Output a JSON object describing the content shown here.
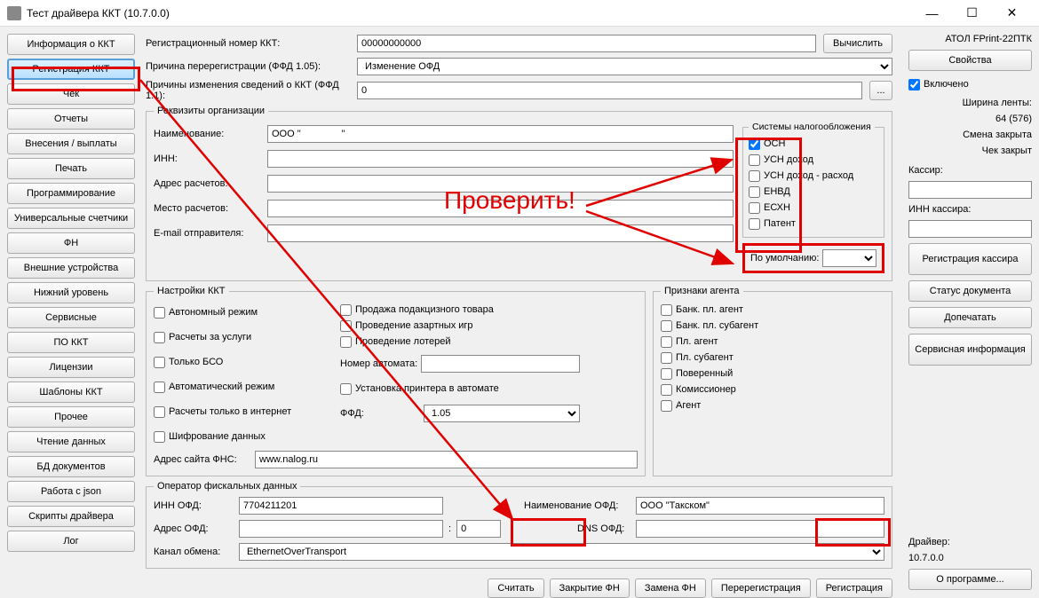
{
  "window": {
    "title": "Тест драйвера ККТ (10.7.0.0)"
  },
  "nav": {
    "items": [
      "Информация о ККТ",
      "Регистрация ККТ",
      "Чек",
      "Отчеты",
      "Внесения / выплаты",
      "Печать",
      "Программирование",
      "Универсальные счетчики",
      "ФН",
      "Внешние устройства",
      "Нижний уровень",
      "Сервисные",
      "ПО ККТ",
      "Лицензии",
      "Шаблоны ККТ",
      "Прочее",
      "Чтение данных",
      "БД документов",
      "Работа с json",
      "Скрипты драйвера",
      "Лог"
    ],
    "active": 1
  },
  "top": {
    "reg_num_label": "Регистрационный номер ККТ:",
    "reg_num_value": "00000000000",
    "calc_btn": "Вычислить",
    "reason_label": "Причина перерегистрации (ФФД 1.05):",
    "reason_value": "Изменение ОФД",
    "reasons11_label": "Причины изменения сведений о ККТ (ФФД 1.1):",
    "reasons11_value": "0",
    "dots": "..."
  },
  "org": {
    "legend": "Реквизиты организации",
    "name_l": "Наименование:",
    "name_v": "ООО \"               \"",
    "inn_l": "ИНН:",
    "inn_v": "",
    "addr_l": "Адрес расчетов:",
    "addr_v": "",
    "place_l": "Место расчетов:",
    "place_v": "",
    "email_l": "E-mail отправителя:",
    "email_v": "",
    "tax_legend": "Системы налогообложения",
    "tax_items": [
      "ОСН",
      "УСН доход",
      "УСН доход - расход",
      "ЕНВД",
      "ЕСХН",
      "Патент"
    ],
    "tax_checked": [
      true,
      false,
      false,
      false,
      false,
      false
    ],
    "default_l": "По умолчанию:",
    "default_v": ""
  },
  "kkt": {
    "legend": "Настройки ККТ",
    "col1": [
      "Автономный режим",
      "Расчеты за услуги",
      "Только БСО",
      "Автоматический режим",
      "Расчеты только в интернет",
      "Шифрование данных"
    ],
    "col2": [
      "Продажа подакцизного товара",
      "Проведение азартных игр",
      "Проведение лотерей"
    ],
    "auto_num_l": "Номер автомата:",
    "auto_num_v": "",
    "printer_l": "Установка принтера в автомате",
    "ffd_l": "ФФД:",
    "ffd_v": "1.05",
    "fns_l": "Адрес сайта ФНС:",
    "fns_v": "www.nalog.ru"
  },
  "agent": {
    "legend": "Признаки агента",
    "items": [
      "Банк. пл. агент",
      "Банк. пл. субагент",
      "Пл. агент",
      "Пл. субагент",
      "Поверенный",
      "Комиссионер",
      "Агент"
    ]
  },
  "ofd": {
    "legend": "Оператор фискальных данных",
    "inn_l": "ИНН ОФД:",
    "inn_v": "7704211201",
    "name_l": "Наименование ОФД:",
    "name_v": "ООО \"Такском\"",
    "addr_l": "Адрес ОФД:",
    "addr_v": "",
    "port_v": "0",
    "dns_l": "DNS ОФД:",
    "dns_v": "",
    "chan_l": "Канал обмена:",
    "chan_v": "EthernetOverTransport"
  },
  "bottom": {
    "read": "Считать",
    "close_fn": "Закрытие ФН",
    "replace_fn": "Замена ФН",
    "rereg": "Перерегистрация",
    "reg": "Регистрация"
  },
  "right": {
    "device": "АТОЛ FPrint-22ПТК",
    "props": "Свойства",
    "enabled": "Включено",
    "width_l": "Ширина ленты:",
    "width_v": "64 (576)",
    "shift": "Смена закрыта",
    "check": "Чек закрыт",
    "cashier_l": "Кассир:",
    "cashier_v": "",
    "cashier_inn_l": "ИНН кассира:",
    "cashier_inn_v": "",
    "reg_cashier": "Регистрация кассира",
    "doc_status": "Статус документа",
    "reprint": "Допечатать",
    "service": "Сервисная информация",
    "driver_l": "Драйвер:",
    "driver_v": "10.7.0.0",
    "about": "О программе..."
  },
  "annot": {
    "check": "Проверить!"
  }
}
